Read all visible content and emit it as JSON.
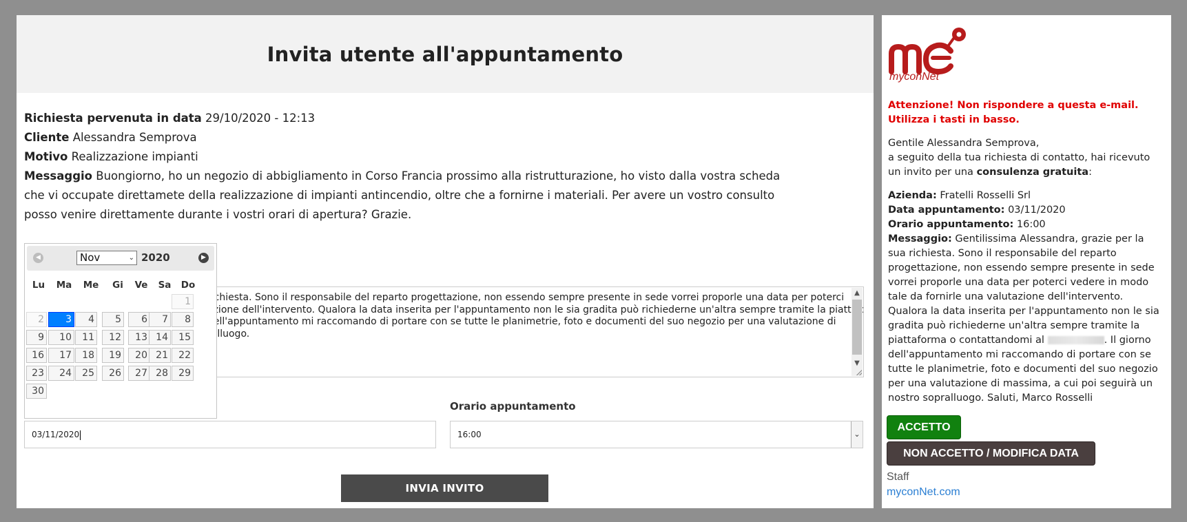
{
  "page": {
    "title": "Invita utente all'appuntamento",
    "request_label": "Richiesta pervenuta in data",
    "request_value": "29/10/2020 - 12:13",
    "client_label": "Cliente",
    "client_value": "Alessandra Semprova",
    "reason_label": "Motivo",
    "reason_value": "Realizzazione impianti",
    "message_label": "Messaggio",
    "message_value": "Buongiorno, ho un negozio di abbigliamento in Corso Francia prossimo alla ristrutturazione, ho visto dalla vostra scheda che vi occupate direttamete della realizzazione di impianti antincendio, oltre che a fornirne i materiali. Per avere un vostro consulto posso venire direttamente durante i vostri orari di apertura? Grazie."
  },
  "textarea": {
    "lines": [
      "richiesta. Sono il responsabile del reparto progettazione, non essendo sempre presente in sede vorrei proporle una data per poterci",
      "azione dell'intervento. Qualora la data inserita per l'appuntamento non le sia gradita può richiederne un'altra sempre tramite la piattaforma",
      " dell'appuntamento mi raccomando di portare con se tutte le planimetrie, foto e documenti del suo negozio per una valutazione di",
      "ralluogo."
    ]
  },
  "form": {
    "time_label": "Orario appuntamento",
    "date_value": "03/11/2020",
    "time_value": "16:00",
    "send_label": "INVIA INVITO"
  },
  "datepicker": {
    "month": "Nov",
    "year": "2020",
    "prev_icon": "◀",
    "next_icon": "▶",
    "weekdays": [
      "Lu",
      "Ma",
      "Me",
      "Gi",
      "Ve",
      "Sa",
      "Do"
    ],
    "days": [
      "1",
      "2",
      "3",
      "4",
      "5",
      "6",
      "7",
      "8",
      "9",
      "10",
      "11",
      "12",
      "13",
      "14",
      "15",
      "16",
      "17",
      "18",
      "19",
      "20",
      "21",
      "22",
      "23",
      "24",
      "25",
      "26",
      "27",
      "28",
      "29",
      "30"
    ],
    "selected": "3",
    "disabled": [
      "1",
      "2"
    ]
  },
  "email": {
    "logo_text": "myconNet",
    "warning": "Attenzione! Non rispondere a questa e-mail. Utilizza i tasti in basso.",
    "greeting": "Gentile Alessandra Semprova,",
    "intro_1": "a seguito della tua richiesta di contatto, hai ricevuto un invito per una ",
    "intro_bold": "consulenza gratuita",
    "intro_2": ":",
    "company_label": "Azienda:",
    "company_value": "Fratelli Rosselli Srl",
    "date_label": "Data appuntamento:",
    "date_value": "03/11/2020",
    "time_label": "Orario appuntamento:",
    "time_value": "16:00",
    "message_label": "Messaggio:",
    "message_part1": "Gentilissima Alessandra, grazie per la sua richiesta. Sono il responsabile del reparto progettazione, non essendo sempre presente in sede vorrei proporle una data per poterci vedere in modo tale da fornirle una valutazione dell'intervento. Qualora la data inserita per l'appuntamento non le sia gradita può richiederne un'altra sempre tramite la piattaforma o contattandomi al",
    "message_part2": ". Il giorno dell'appuntamento mi raccomando di portare con se tutte le planimetrie, foto e documenti del suo negozio per una valutazione di massima, a cui poi seguirà un nostro sopralluogo. Saluti, Marco Rosselli",
    "accept_label": "ACCETTO",
    "decline_label": "NON ACCETTO / MODIFICA DATA",
    "staff": "Staff",
    "site": "myconNet.com"
  },
  "colors": {
    "accent_red": "#e00000",
    "accept_green": "#11810f",
    "decline_brown": "#4a3f3f",
    "link_blue": "#2b7fd3",
    "selected_day": "#007fff"
  }
}
